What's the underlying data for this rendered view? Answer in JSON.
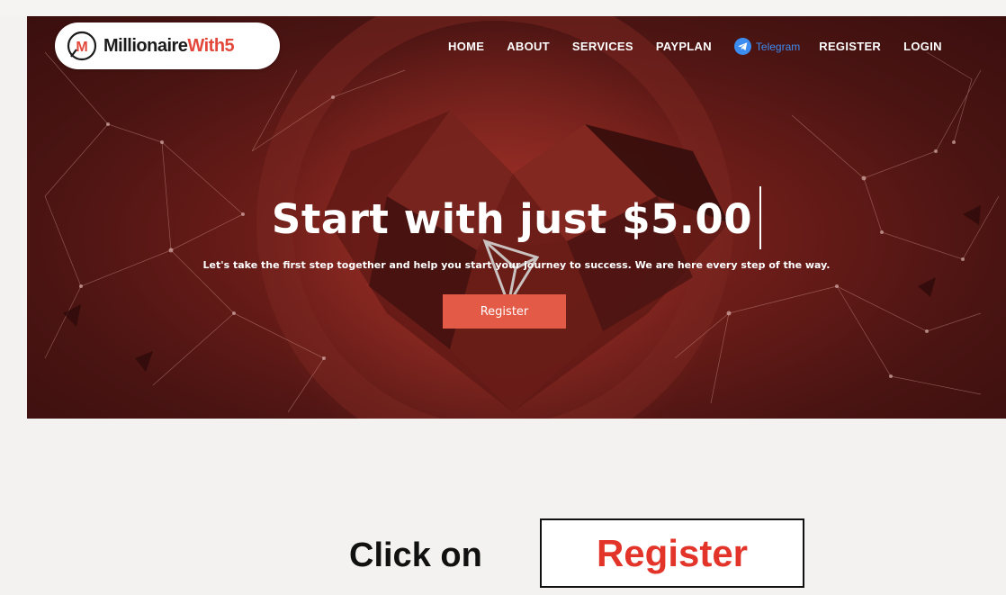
{
  "brand": {
    "name_main": "Millionaire",
    "name_accent": "With5",
    "logo_letter": "M"
  },
  "nav": {
    "items": [
      "HOME",
      "ABOUT",
      "SERVICES",
      "PAYPLAN"
    ],
    "telegram_label": "Telegram",
    "register_label": "REGISTER",
    "login_label": "LOGIN"
  },
  "hero": {
    "title": "Start with just $5.00",
    "subtitle": "Let's take the first step together and help you start your journey to success. We are here every step of the way.",
    "button_label": "Register"
  },
  "instruction": {
    "text": "Click on",
    "target_label": "Register"
  },
  "colors": {
    "accent": "#e35a47",
    "hero_background": "#6d1d19",
    "telegram": "#3d8cf0",
    "instruction_highlight": "#e3342a"
  },
  "icons": [
    "logo-icon",
    "telegram-icon",
    "tron-logo-icon"
  ]
}
